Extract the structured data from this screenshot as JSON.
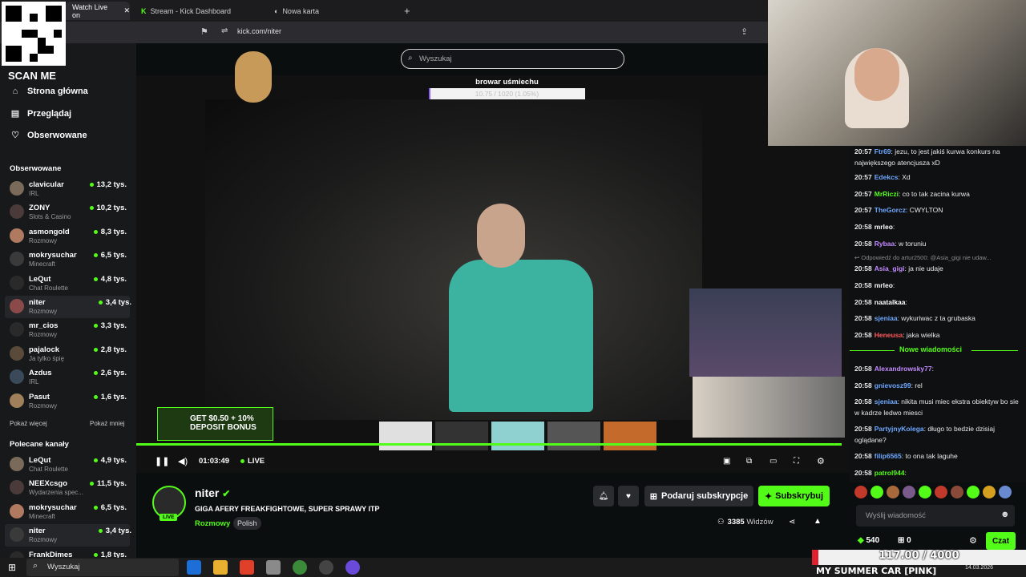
{
  "browser": {
    "tabs": [
      {
        "label": "Watch Live on"
      },
      {
        "label": "Stream - Kick Dashboard"
      },
      {
        "label": "Nowa karta"
      }
    ],
    "url": "kick.com/niter"
  },
  "overlay": {
    "scan_me": "SCAN ME",
    "webcam_counter": "117.00 / 4000",
    "webcam_counter_progress": 0.029,
    "game_title": "MY SUMMER CAR [PINK]",
    "date": "14.03.2026"
  },
  "search": {
    "placeholder": "Wyszukaj"
  },
  "nav": {
    "home": "Strona główna",
    "browse": "Przeglądaj",
    "following": "Obserwowane"
  },
  "sidebar": {
    "followed_title": "Obserwowane",
    "followed": [
      {
        "name": "clavicular",
        "category": "IRL",
        "viewers": "13,2 tys."
      },
      {
        "name": "ZONY",
        "category": "Slots & Casino",
        "viewers": "10,2 tys."
      },
      {
        "name": "asmongold",
        "category": "Rozmowy",
        "viewers": "8,3 tys."
      },
      {
        "name": "mokrysuchar",
        "category": "Minecraft",
        "viewers": "6,5 tys."
      },
      {
        "name": "LeQut",
        "category": "Chat Roulette",
        "viewers": "4,8 tys."
      },
      {
        "name": "niter",
        "category": "Rozmowy",
        "viewers": "3,4 tys."
      },
      {
        "name": "mr_cios",
        "category": "Rozmowy",
        "viewers": "3,3 tys."
      },
      {
        "name": "pajalock",
        "category": "Ja tylko śpię",
        "viewers": "2,8 tys."
      },
      {
        "name": "Azdus",
        "category": "IRL",
        "viewers": "2,6 tys."
      },
      {
        "name": "Pasut",
        "category": "Rozmowy",
        "viewers": "1,6 tys."
      }
    ],
    "show_more": "Pokaż więcej",
    "show_less": "Pokaż mniej",
    "recommended_title": "Polecane kanały",
    "recommended": [
      {
        "name": "LeQut",
        "category": "Chat Roulette",
        "viewers": "4,9 tys."
      },
      {
        "name": "NEEXcsgo",
        "category": "Wydarzenia spec...",
        "viewers": "11,5 tys."
      },
      {
        "name": "mokrysuchar",
        "category": "Minecraft",
        "viewers": "6,5 tys."
      },
      {
        "name": "niter",
        "category": "Rozmowy",
        "viewers": "3,4 tys."
      },
      {
        "name": "FrankDimes",
        "category": "",
        "viewers": "1,8 tys."
      }
    ]
  },
  "player": {
    "goal_title": "browar uśmiechu",
    "goal_text": "10.75 / 1020 (1.05%)",
    "goal_progress": 0.0105,
    "banner": "GET $0.50 + 10% DEPOSIT BONUS",
    "time": "01:03:49",
    "live_label": "LIVE"
  },
  "stream": {
    "streamer": "niter",
    "live_badge": "LIVE",
    "title": "GIGA AFERY FREAKFIGHTOWE, SUPER SPRAWY ITP",
    "category": "Rozmowy",
    "language": "Polish",
    "gift_button": "Podaruj subskrypcje",
    "subscribe_button": "Subskrybuj",
    "viewers": "3385",
    "viewers_label": "Widzów"
  },
  "chat": {
    "messages": [
      {
        "time": "20:57",
        "user": "Ftr69",
        "color": "#6fa8ff",
        "text": ": jezu, to jest jakiś kurwa konkurs na największego atencjusza xD"
      },
      {
        "time": "20:57",
        "user": "Edekcs",
        "color": "#6fa8ff",
        "text": ": Xd"
      },
      {
        "time": "20:57",
        "user": "MrRiczi",
        "color": "#53fc18",
        "text": ": co to tak zacina kurwa"
      },
      {
        "time": "20:57",
        "user": "TheGorcz",
        "color": "#6fa8ff",
        "text": ": CWYLTON"
      },
      {
        "time": "20:58",
        "user": "mrleo",
        "color": "#ffffff",
        "text": ":"
      },
      {
        "time": "20:58",
        "user": "Rybaa",
        "color": "#c48cff",
        "text": ": w toruniu"
      },
      {
        "time": "20:58",
        "user": "Asia_gigi",
        "color": "#c48cff",
        "text": ": ja nie udaje"
      },
      {
        "time": "20:58",
        "user": "mrleo",
        "color": "#ffffff",
        "text": ":"
      },
      {
        "time": "20:58",
        "user": "naatalkaa",
        "color": "#ffffff",
        "text": ":"
      },
      {
        "time": "20:58",
        "user": "sjeniaa",
        "color": "#6fa8ff",
        "text": ": wykuriwac z ta grubaska"
      },
      {
        "time": "20:58",
        "user": "Heneusa",
        "color": "#ff5a5a",
        "text": ": jaka wielka"
      },
      {
        "time": "20:58",
        "user": "Alexandrowsky77",
        "color": "#c48cff",
        "text": ":"
      },
      {
        "time": "20:58",
        "user": "gnievosz99",
        "color": "#6fa8ff",
        "text": ": rel"
      },
      {
        "time": "20:58",
        "user": "sjeniaa",
        "color": "#6fa8ff",
        "text": ": nikita musi miec ekstra obiektyw bo sie w kadrze ledwo miesci"
      },
      {
        "time": "20:58",
        "user": "PartyjnyKolega",
        "color": "#6fa8ff",
        "text": ": długo to bedzie dzisiaj oglądane?"
      },
      {
        "time": "20:58",
        "user": "filip6565",
        "color": "#6fa8ff",
        "text": ": to ona tak laguhe"
      },
      {
        "time": "20:58",
        "user": "patrol944",
        "color": "#53fc18",
        "text": ":"
      }
    ],
    "reply_note": "Odpowiedź do artur2500: @Asia_gigi nie udaw...",
    "new_messages": "Nowe wiadomości",
    "input_placeholder": "Wyślij wiadomość",
    "points": "540",
    "gifts": "0",
    "send_label": "Czat"
  },
  "taskbar": {
    "search": "Wyszukaj"
  }
}
